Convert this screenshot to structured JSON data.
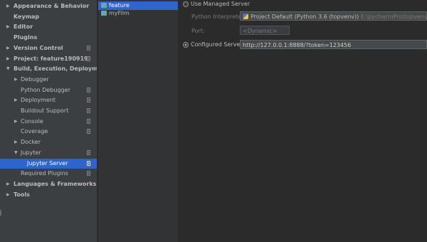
{
  "sidebar": {
    "items": [
      {
        "label": "Appearance & Behavior",
        "level": 0,
        "arrow": "right",
        "bold": true,
        "project_icon": false
      },
      {
        "label": "Keymap",
        "level": 0,
        "arrow": "none",
        "bold": true,
        "project_icon": false
      },
      {
        "label": "Editor",
        "level": 0,
        "arrow": "right",
        "bold": true,
        "project_icon": false
      },
      {
        "label": "Plugins",
        "level": 0,
        "arrow": "none",
        "bold": true,
        "project_icon": false
      },
      {
        "label": "Version Control",
        "level": 0,
        "arrow": "right",
        "bold": true,
        "project_icon": true
      },
      {
        "label": "Project: feature190919",
        "level": 0,
        "arrow": "right",
        "bold": true,
        "project_icon": true
      },
      {
        "label": "Build, Execution, Deployment",
        "level": 0,
        "arrow": "down",
        "bold": true,
        "project_icon": false
      },
      {
        "label": "Debugger",
        "level": 1,
        "arrow": "right",
        "bold": false,
        "project_icon": false
      },
      {
        "label": "Python Debugger",
        "level": 1,
        "arrow": "none",
        "bold": false,
        "project_icon": true
      },
      {
        "label": "Deployment",
        "level": 1,
        "arrow": "right",
        "bold": false,
        "project_icon": true
      },
      {
        "label": "Buildout Support",
        "level": 1,
        "arrow": "none",
        "bold": false,
        "project_icon": true
      },
      {
        "label": "Console",
        "level": 1,
        "arrow": "right",
        "bold": false,
        "project_icon": true
      },
      {
        "label": "Coverage",
        "level": 1,
        "arrow": "none",
        "bold": false,
        "project_icon": true
      },
      {
        "label": "Docker",
        "level": 1,
        "arrow": "right",
        "bold": false,
        "project_icon": false
      },
      {
        "label": "Jupyter",
        "level": 1,
        "arrow": "down",
        "bold": false,
        "project_icon": true
      },
      {
        "label": "Jupyter Server",
        "level": 2,
        "arrow": "none",
        "bold": false,
        "project_icon": true,
        "selected": true
      },
      {
        "label": "Required Plugins",
        "level": 1,
        "arrow": "none",
        "bold": false,
        "project_icon": true
      },
      {
        "label": "Languages & Frameworks",
        "level": 0,
        "arrow": "right",
        "bold": true,
        "project_icon": false
      },
      {
        "label": "Tools",
        "level": 0,
        "arrow": "right",
        "bold": true,
        "project_icon": false
      }
    ]
  },
  "projects": {
    "items": [
      {
        "label": "feature",
        "selected": true
      },
      {
        "label": "myFilm",
        "selected": false
      }
    ]
  },
  "settings": {
    "use_managed_label": "Use Managed Server",
    "interpreter_label": "Python Interpreter:",
    "interpreter_value": "Project Default (Python 3.6 (topvenv))",
    "interpreter_path": "E:\\pycharmPro\\topvenv\\Scripts\\",
    "port_label": "Port:",
    "port_placeholder": "<Dynamic>",
    "configured_label": "Configured Server:",
    "configured_value": "http://127.0.0.1:8888/?token=123456"
  },
  "colors": {
    "accent": "#2f65ca",
    "sidebar_bg": "#3c3f41",
    "content_bg": "#2b2b2b"
  }
}
